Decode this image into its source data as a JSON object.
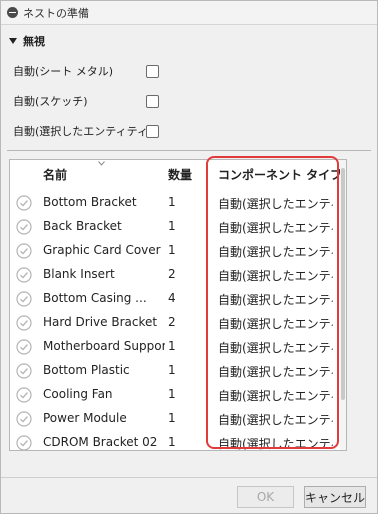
{
  "window": {
    "title": "ネストの準備"
  },
  "section": {
    "label": "無視"
  },
  "options": [
    {
      "label": "自動(シート メタル)",
      "checked": false
    },
    {
      "label": "自動(スケッチ)",
      "checked": false
    },
    {
      "label": "自動(選択したエンティティ)",
      "checked": false
    }
  ],
  "table": {
    "headers": {
      "name": "名前",
      "quantity": "数量",
      "component_type": "コンポーネント タイプ"
    },
    "rows": [
      {
        "name": "Bottom Bracket",
        "quantity": "1",
        "type": "自動(選択したエンティ..."
      },
      {
        "name": "Back Bracket",
        "quantity": "1",
        "type": "自動(選択したエンティ..."
      },
      {
        "name": "Graphic Card Cover",
        "quantity": "1",
        "type": "自動(選択したエンティ..."
      },
      {
        "name": "Blank Insert",
        "quantity": "2",
        "type": "自動(選択したエンティ..."
      },
      {
        "name": "Bottom Casing ...",
        "quantity": "4",
        "type": "自動(選択したエンティ..."
      },
      {
        "name": "Hard Drive Bracket",
        "quantity": "2",
        "type": "自動(選択したエンティ..."
      },
      {
        "name": "Motherboard Support",
        "quantity": "1",
        "type": "自動(選択したエンティ..."
      },
      {
        "name": "Bottom Plastic",
        "quantity": "1",
        "type": "自動(選択したエンティ..."
      },
      {
        "name": "Cooling Fan",
        "quantity": "1",
        "type": "自動(選択したエンティ..."
      },
      {
        "name": "Power Module",
        "quantity": "1",
        "type": "自動(選択したエンティ..."
      },
      {
        "name": "CDROM Bracket 02",
        "quantity": "1",
        "type": "自動(選択したエンティ..."
      }
    ]
  },
  "buttons": {
    "ok": "OK",
    "cancel": "キャンセル"
  },
  "colors": {
    "highlight": "#e23b3b",
    "accent": "#222222"
  }
}
